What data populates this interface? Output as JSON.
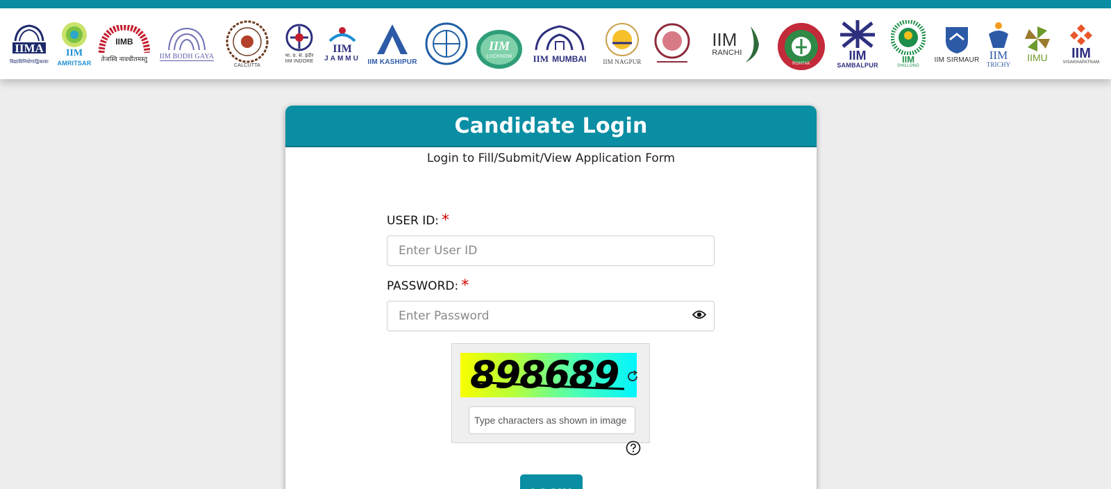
{
  "header": {
    "bar_color": "#0a8ea3",
    "logos": [
      {
        "name": "iima",
        "text": "IIMA",
        "sub": "विद्याविनियोगाद्विकासः"
      },
      {
        "name": "iim-amritsar",
        "text": "IIM",
        "sub": "AMRITSAR"
      },
      {
        "name": "iimb",
        "text": "IIMB",
        "sub": "तेजस्वि नावधीतमस्तु"
      },
      {
        "name": "iim-bodh-gaya",
        "text": "IIM BODH GAYA",
        "sub": ""
      },
      {
        "name": "iim-calcutta",
        "text": "",
        "sub": "CALCUTTA"
      },
      {
        "name": "iim-indore",
        "text": "भा. प्र. सं. इंदौर",
        "sub": "IIM INDORE"
      },
      {
        "name": "iim-jammu",
        "text": "IIM",
        "sub": "JAMMU"
      },
      {
        "name": "iim-kashipur",
        "text": "",
        "sub": "IIM KASHIPUR"
      },
      {
        "name": "iim-kozhikode",
        "text": "",
        "sub": ""
      },
      {
        "name": "iim-lucknow",
        "text": "IIM",
        "sub": "LUCKNOW"
      },
      {
        "name": "iim-mumbai",
        "text": "IIM",
        "sub": "MUMBAI"
      },
      {
        "name": "iim-nagpur",
        "text": "",
        "sub": "IIM NAGPUR"
      },
      {
        "name": "iim-raipur",
        "text": "",
        "sub": ""
      },
      {
        "name": "iim-ranchi",
        "text": "IIM",
        "sub": "RANCHI"
      },
      {
        "name": "iim-rohtak",
        "text": "",
        "sub": "ROHTAK"
      },
      {
        "name": "iim-sambalpur",
        "text": "IIM",
        "sub": "SAMBALPUR"
      },
      {
        "name": "iim-shillong",
        "text": "IIM",
        "sub": "SHILLONG"
      },
      {
        "name": "iim-sirmaur",
        "text": "IIM SIRMAUR",
        "sub": ""
      },
      {
        "name": "iim-trichy",
        "text": "IIM",
        "sub": "TRICHY"
      },
      {
        "name": "iimu",
        "text": "IIMU",
        "sub": ""
      },
      {
        "name": "iim-visakhapatnam",
        "text": "IIM",
        "sub": "VISAKHAPATNAM"
      }
    ]
  },
  "login": {
    "title": "Candidate Login",
    "subtitle": "Login to Fill/Submit/View Application Form",
    "user_id_label": "USER ID:",
    "user_id_placeholder": "Enter User ID",
    "password_label": "PASSWORD:",
    "password_placeholder": "Enter Password",
    "required_mark": "*",
    "captcha_code": "898689",
    "captcha_placeholder": "Type characters as shown in image",
    "login_button": "LOGIN",
    "accent_color": "#0a8ea3",
    "required_color": "#d40000"
  }
}
